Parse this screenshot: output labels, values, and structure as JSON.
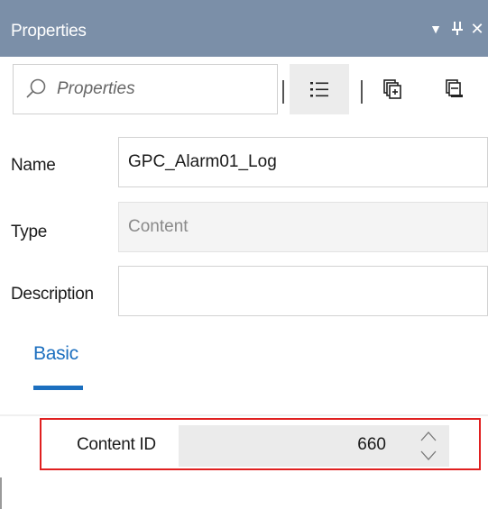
{
  "panel": {
    "title": "Properties",
    "title_bar_color": "#7b8fa8",
    "controls": {
      "dropdown_glyph": "▼",
      "pin_glyph": "ᵽ",
      "close_glyph": "✕"
    }
  },
  "toolbar": {
    "search_placeholder": "Properties",
    "search_icon": "search-icon",
    "buttons": [
      {
        "name": "categorized-list-button",
        "icon": "list-icon"
      },
      {
        "name": "collapse-all-button",
        "icon": "collapse-icon"
      },
      {
        "name": "expand-all-button",
        "icon": "expand-icon"
      }
    ]
  },
  "fields": {
    "name": {
      "label": "Name",
      "value": "GPC_Alarm01_Log"
    },
    "type": {
      "label": "Type",
      "value": "Content"
    },
    "description": {
      "label": "Description",
      "value": ""
    }
  },
  "tabs": [
    {
      "label": "Basic",
      "active": true
    }
  ],
  "basic": {
    "content_id": {
      "label": "Content ID",
      "value": "660"
    }
  },
  "colors": {
    "accent": "#1c6fbf",
    "highlight_border": "#e02020"
  }
}
